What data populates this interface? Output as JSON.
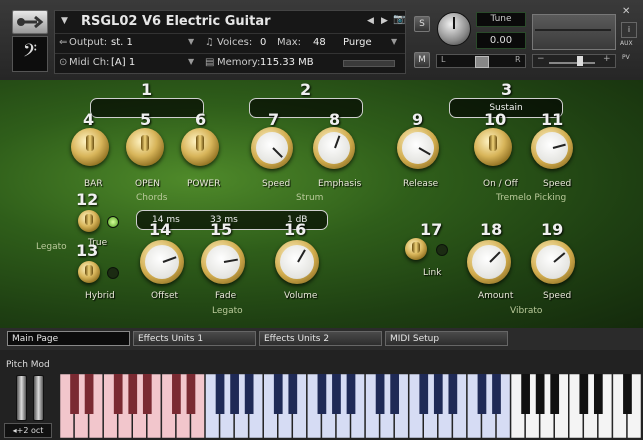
{
  "header": {
    "instrument_name": "RSGL02 V6 Electric Guitar",
    "output_label": "Output:",
    "output_value": "st. 1",
    "voices_label": "Voices:",
    "voices_value": "0",
    "max_label": "Max:",
    "max_value": "48",
    "purge_label": "Purge",
    "midi_label": "Midi Ch:",
    "midi_value": "[A] 1",
    "memory_label": "Memory:",
    "memory_value": "115.33 MB",
    "s_label": "S",
    "m_label": "M",
    "tune_label": "Tune",
    "tune_value": "0.00",
    "aux_label": "AUX",
    "pv_label": "PV",
    "pan_l": "L",
    "pan_r": "R",
    "clef_glyph": "𝄢",
    "accent_color": "#4f8a2a"
  },
  "controls": {
    "group_numbers": [
      "1",
      "2",
      "3"
    ],
    "sustain_display": "Sustain",
    "legato_displays": [
      "14 ms",
      "33 ms",
      "1 dB"
    ],
    "numbers": [
      "4",
      "5",
      "6",
      "7",
      "8",
      "9",
      "10",
      "11",
      "12",
      "13",
      "14",
      "15",
      "16",
      "17",
      "18",
      "19"
    ],
    "labels": {
      "bar": "BAR",
      "open": "OPEN",
      "power": "POWER",
      "speed_strum": "Speed",
      "emphasis": "Emphasis",
      "release": "Release",
      "on_off": "On / Off",
      "speed_tremolo": "Speed",
      "true": "True",
      "hybrid": "Hybrid",
      "offset": "Offset",
      "fade": "Fade",
      "volume": "Volume",
      "link": "Link",
      "amount": "Amount",
      "speed_vibrato": "Speed"
    },
    "groups": {
      "chords": "Chords",
      "strum": "Strum",
      "tremolo": "Tremelo Picking",
      "legato_left": "Legato",
      "legato_bottom": "Legato",
      "vibrato": "Vibrato"
    }
  },
  "tabs": [
    "Main Page",
    "Effects Units 1",
    "Effects Units 2",
    "MIDI Setup"
  ],
  "keyboard": {
    "pitch_mod_label": "Pitch Mod",
    "octave_label": "+2 oct"
  }
}
